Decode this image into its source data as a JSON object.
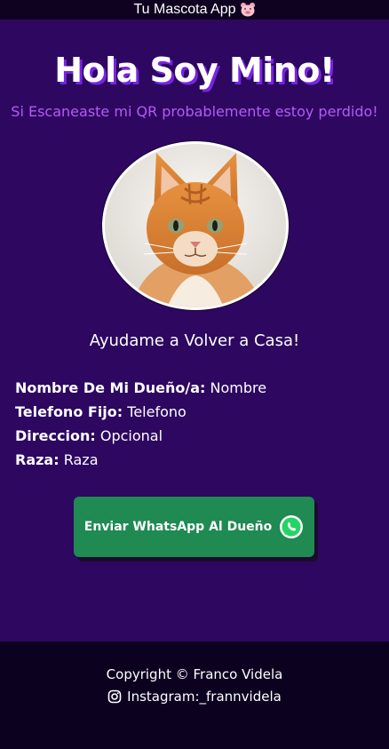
{
  "topbar": {
    "title": "Tu Mascota App",
    "icon": "pig-face-icon"
  },
  "header": {
    "title": "Hola Soy Mino!",
    "subtitle": "Si Escaneaste mi QR probablemente estoy perdido!"
  },
  "pet_photo": {
    "icon": "cat-photo"
  },
  "help_text": "Ayudame a Volver a Casa!",
  "info": [
    {
      "label": "Nombre De Mi Dueño/a:",
      "value": "Nombre"
    },
    {
      "label": "Telefono Fijo:",
      "value": "Telefono"
    },
    {
      "label": "Direccion:",
      "value": "Opcional"
    },
    {
      "label": "Raza:",
      "value": "Raza"
    }
  ],
  "whatsapp_button": {
    "label": "Enviar WhatsApp Al Dueño",
    "icon": "whatsapp-icon",
    "color": "#1f8a52"
  },
  "footer": {
    "copyright": "Copyright © Franco Videla",
    "instagram": "Instagram:_frannvidela",
    "icon": "instagram-icon"
  },
  "colors": {
    "background": "#2d0760",
    "accent": "#b45bf5",
    "footer": "#0d0120"
  }
}
